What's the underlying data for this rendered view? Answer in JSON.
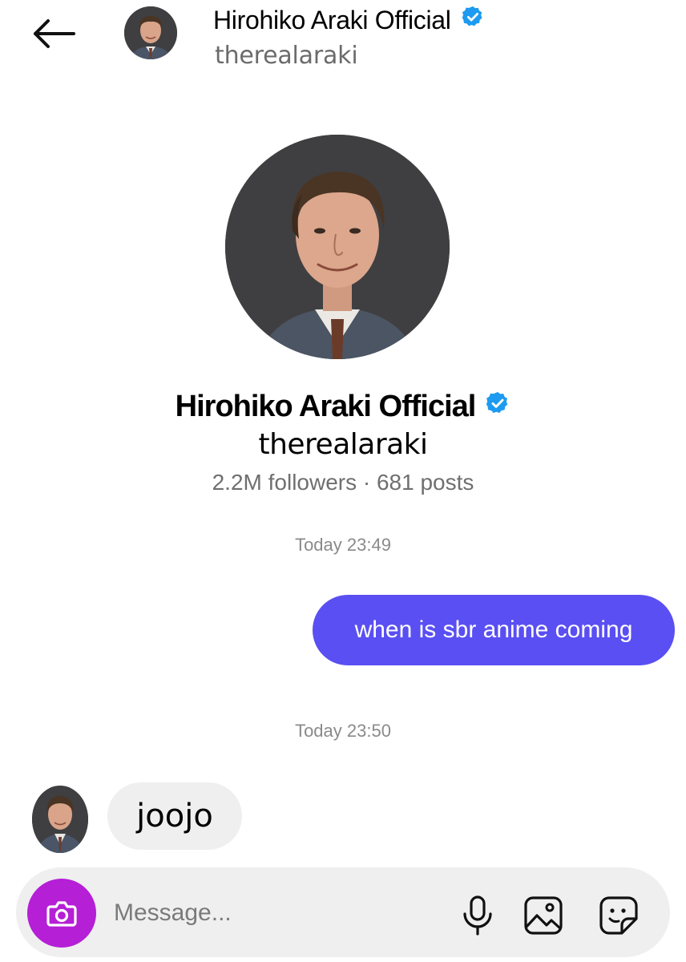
{
  "header": {
    "name": "Hirohiko Araki Official",
    "handle": "therealaraki"
  },
  "profile": {
    "name": "Hirohiko Araki Official",
    "handle": "therealaraki",
    "stats": "2.2M followers · 681 posts"
  },
  "conversation": [
    {
      "timestamp": "Today 23:49",
      "direction": "sent",
      "text": "when is sbr anime coming"
    },
    {
      "timestamp": "Today 23:50",
      "direction": "received",
      "text": "joojo"
    }
  ],
  "composer": {
    "placeholder": "Message..."
  },
  "icons": {
    "back": "arrow-left-icon",
    "verified": "verified-badge-icon",
    "camera": "camera-icon",
    "mic": "microphone-icon",
    "gallery": "image-icon",
    "sticker": "sticker-icon"
  },
  "colors": {
    "sent_bubble": "#5a4ff2",
    "received_bubble": "#efefef",
    "camera_button": "#b51fd6",
    "verified": "#1d9bf0"
  }
}
